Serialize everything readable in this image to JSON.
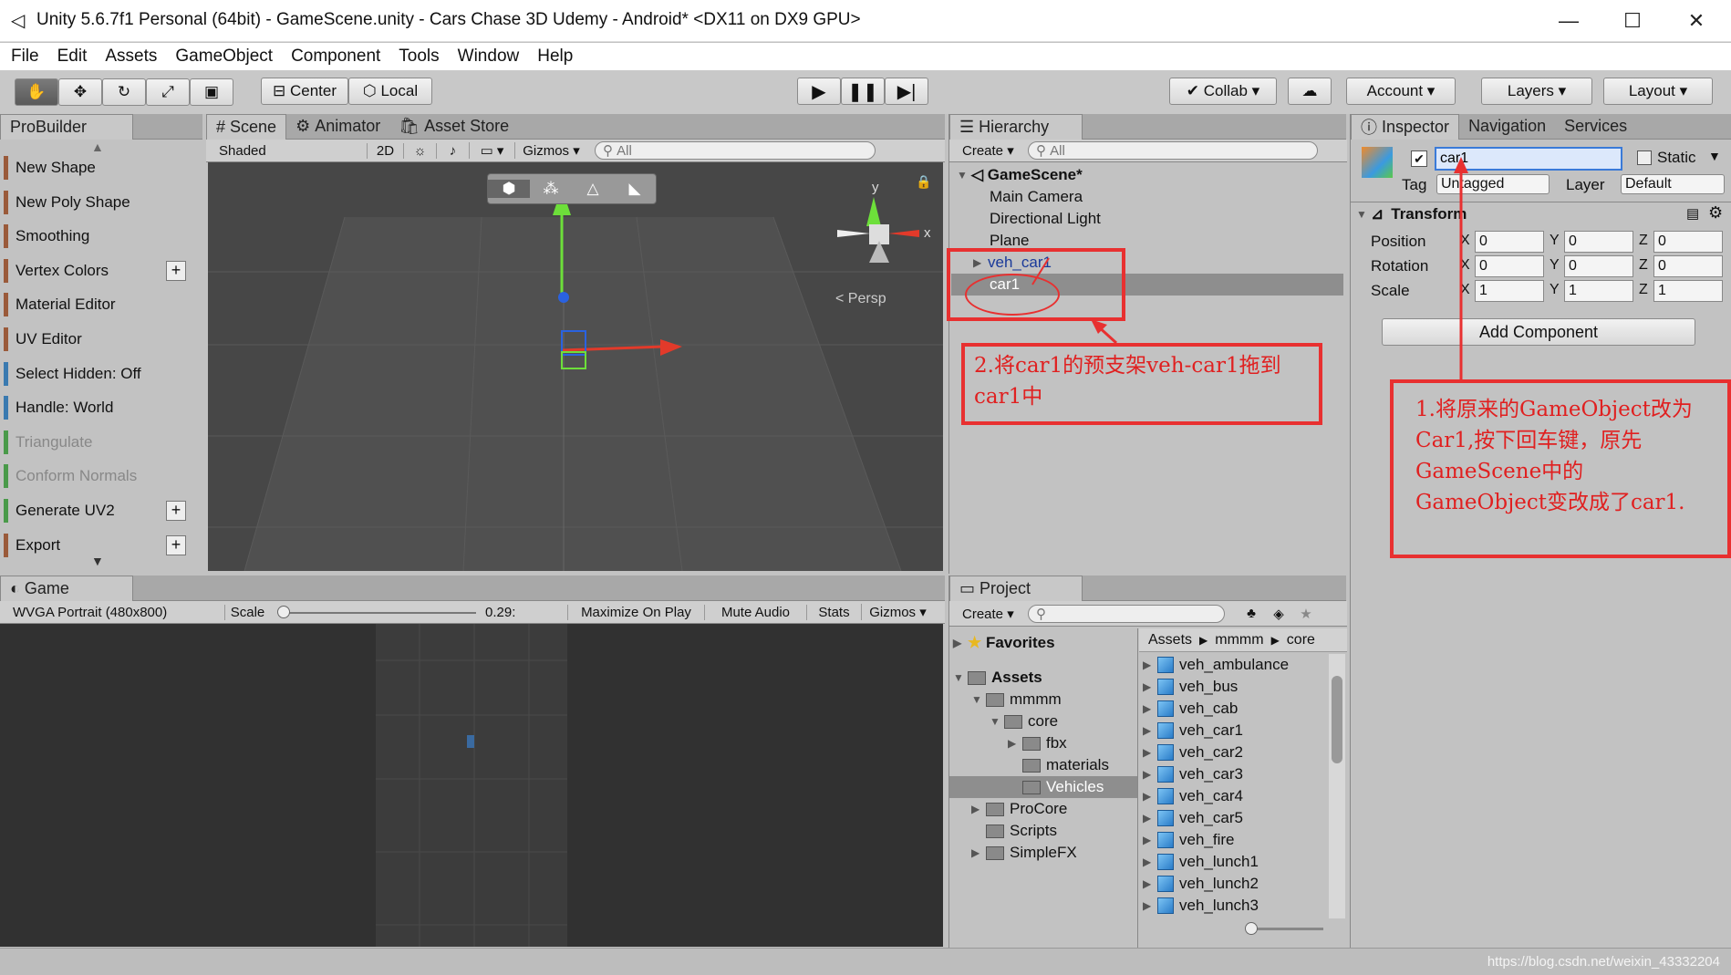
{
  "window": {
    "title": "Unity 5.6.7f1 Personal (64bit) - GameScene.unity - Cars Chase 3D Udemy - Android* <DX11 on DX9 GPU>",
    "min": "—",
    "max": "☐",
    "close": "✕"
  },
  "menu": [
    "File",
    "Edit",
    "Assets",
    "GameObject",
    "Component",
    "Tools",
    "Window",
    "Help"
  ],
  "toolbar": {
    "center": "Center",
    "local": "Local",
    "collab": "Collab ▾",
    "account": "Account ▾",
    "layers": "Layers ▾",
    "layout": "Layout ▾"
  },
  "probuilder": {
    "tab": "ProBuilder",
    "items": [
      {
        "label": "New Shape",
        "color": "#9a5a3a",
        "plus": false,
        "disabled": false
      },
      {
        "label": "New Poly Shape",
        "color": "#9a5a3a",
        "plus": false,
        "disabled": false
      },
      {
        "label": "Smoothing",
        "color": "#9a5a3a",
        "plus": false,
        "disabled": false
      },
      {
        "label": "Vertex Colors",
        "color": "#9a5a3a",
        "plus": true,
        "disabled": false
      },
      {
        "label": "Material Editor",
        "color": "#9a5a3a",
        "plus": false,
        "disabled": false
      },
      {
        "label": "UV Editor",
        "color": "#9a5a3a",
        "plus": false,
        "disabled": false
      },
      {
        "label": "Select Hidden: Off",
        "color": "#3a7ab0",
        "plus": false,
        "disabled": false
      },
      {
        "label": "Handle: World",
        "color": "#3a7ab0",
        "plus": false,
        "disabled": false
      },
      {
        "label": "Triangulate",
        "color": "#4a9a4a",
        "plus": false,
        "disabled": true
      },
      {
        "label": "Conform Normals",
        "color": "#4a9a4a",
        "plus": false,
        "disabled": true
      },
      {
        "label": "Generate UV2",
        "color": "#4a9a4a",
        "plus": true,
        "disabled": false
      },
      {
        "label": "Export",
        "color": "#9a5a3a",
        "plus": true,
        "disabled": false
      }
    ]
  },
  "scene": {
    "tabs": [
      "# Scene",
      "Animator",
      "Asset Store"
    ],
    "shaded": "Shaded",
    "2d": "2D",
    "gizmos": "Gizmos ▾",
    "search": "All",
    "persp": "< Persp",
    "y": "y",
    "x": "x"
  },
  "hierarchy": {
    "tab": "Hierarchy",
    "create": "Create ▾",
    "search": "All",
    "root": "GameScene*",
    "items": [
      "Main Camera",
      "Directional Light",
      "Plane",
      "veh_car1",
      "car1"
    ]
  },
  "inspector": {
    "tabs": [
      "Inspector",
      "Navigation",
      "Services"
    ],
    "name": "car1",
    "static": "Static",
    "tag_label": "Tag",
    "tag": "Untagged",
    "layer_label": "Layer",
    "layer": "Default",
    "transform": "Transform",
    "rows": [
      {
        "label": "Position",
        "x": "0",
        "y": "0",
        "z": "0"
      },
      {
        "label": "Rotation",
        "x": "0",
        "y": "0",
        "z": "0"
      },
      {
        "label": "Scale",
        "x": "1",
        "y": "1",
        "z": "1"
      }
    ],
    "add": "Add Component"
  },
  "game": {
    "tab": "Game",
    "res": "WVGA Portrait (480x800)",
    "scale": "Scale",
    "scale_val": "0.29:",
    "max": "Maximize On Play",
    "mute": "Mute Audio",
    "stats": "Stats",
    "gizmos": "Gizmos ▾"
  },
  "project": {
    "tab": "Project",
    "create": "Create ▾",
    "favorites": "Favorites",
    "assets": "Assets",
    "tree": [
      "mmmm",
      "core",
      "fbx",
      "materials",
      "Vehicles",
      "ProCore",
      "Scripts",
      "SimpleFX"
    ],
    "breadcrumb": [
      "Assets",
      "mmmm",
      "core"
    ],
    "files": [
      "veh_ambulance",
      "veh_bus",
      "veh_cab",
      "veh_car1",
      "veh_car2",
      "veh_car3",
      "veh_car4",
      "veh_car5",
      "veh_fire",
      "veh_lunch1",
      "veh_lunch2",
      "veh_lunch3"
    ]
  },
  "annotations": {
    "a1": "1.将原来的GameObject改为Car1,按下回车键，原先GameScene中的GameObject变改成了car1.",
    "a2": "2.将car1的预支架veh-car1拖到car1中"
  },
  "watermark": "https://blog.csdn.net/weixin_43332204"
}
